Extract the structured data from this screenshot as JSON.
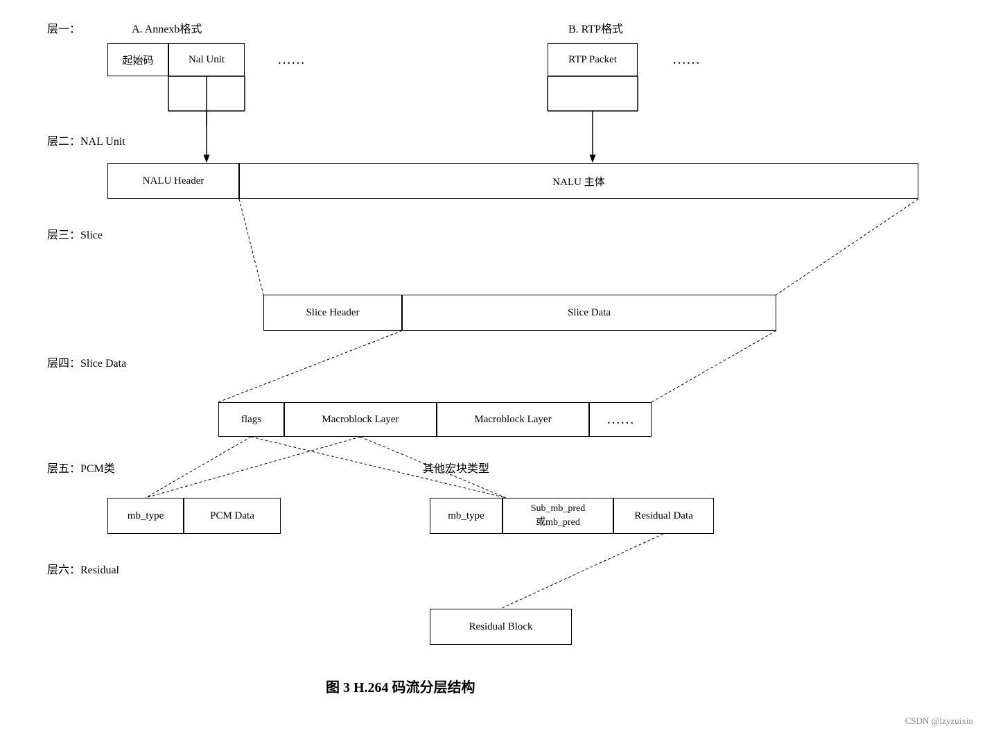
{
  "labels": {
    "layer1": "层一：",
    "layer1a": "A. Annexb格式",
    "layer1b": "B. RTP格式",
    "layer2": "层二：NAL Unit",
    "layer3": "层三：Slice",
    "layer4": "层四：Slice Data",
    "layer5": "层五：PCM类",
    "layer5b": "其他宏块类型",
    "layer6": "层六：Residual",
    "caption": "图 3 H.264 码流分层结构",
    "watermark": "CSDN @lzyzuixin",
    "dots": "……",
    "dots2": "……",
    "dots3": "……"
  },
  "boxes": {
    "qishi": "起始码",
    "nalunit_a": "Nal Unit",
    "rtppacket": "RTP Packet",
    "nalu_header": "NALU Header",
    "nalu_body": "NALU 主体",
    "slice_header": "Slice Header",
    "slice_data": "Slice Data",
    "flags": "flags",
    "macro1": "Macroblock Layer",
    "macro2": "Macroblock Layer",
    "mb_type_pcm": "mb_type",
    "pcm_data": "PCM Data",
    "mb_type_other": "mb_type",
    "sub_mb_pred": "Sub_mb_pred\n或mb_pred",
    "residual_data": "Residual Data",
    "residual_block": "Residual Block"
  }
}
